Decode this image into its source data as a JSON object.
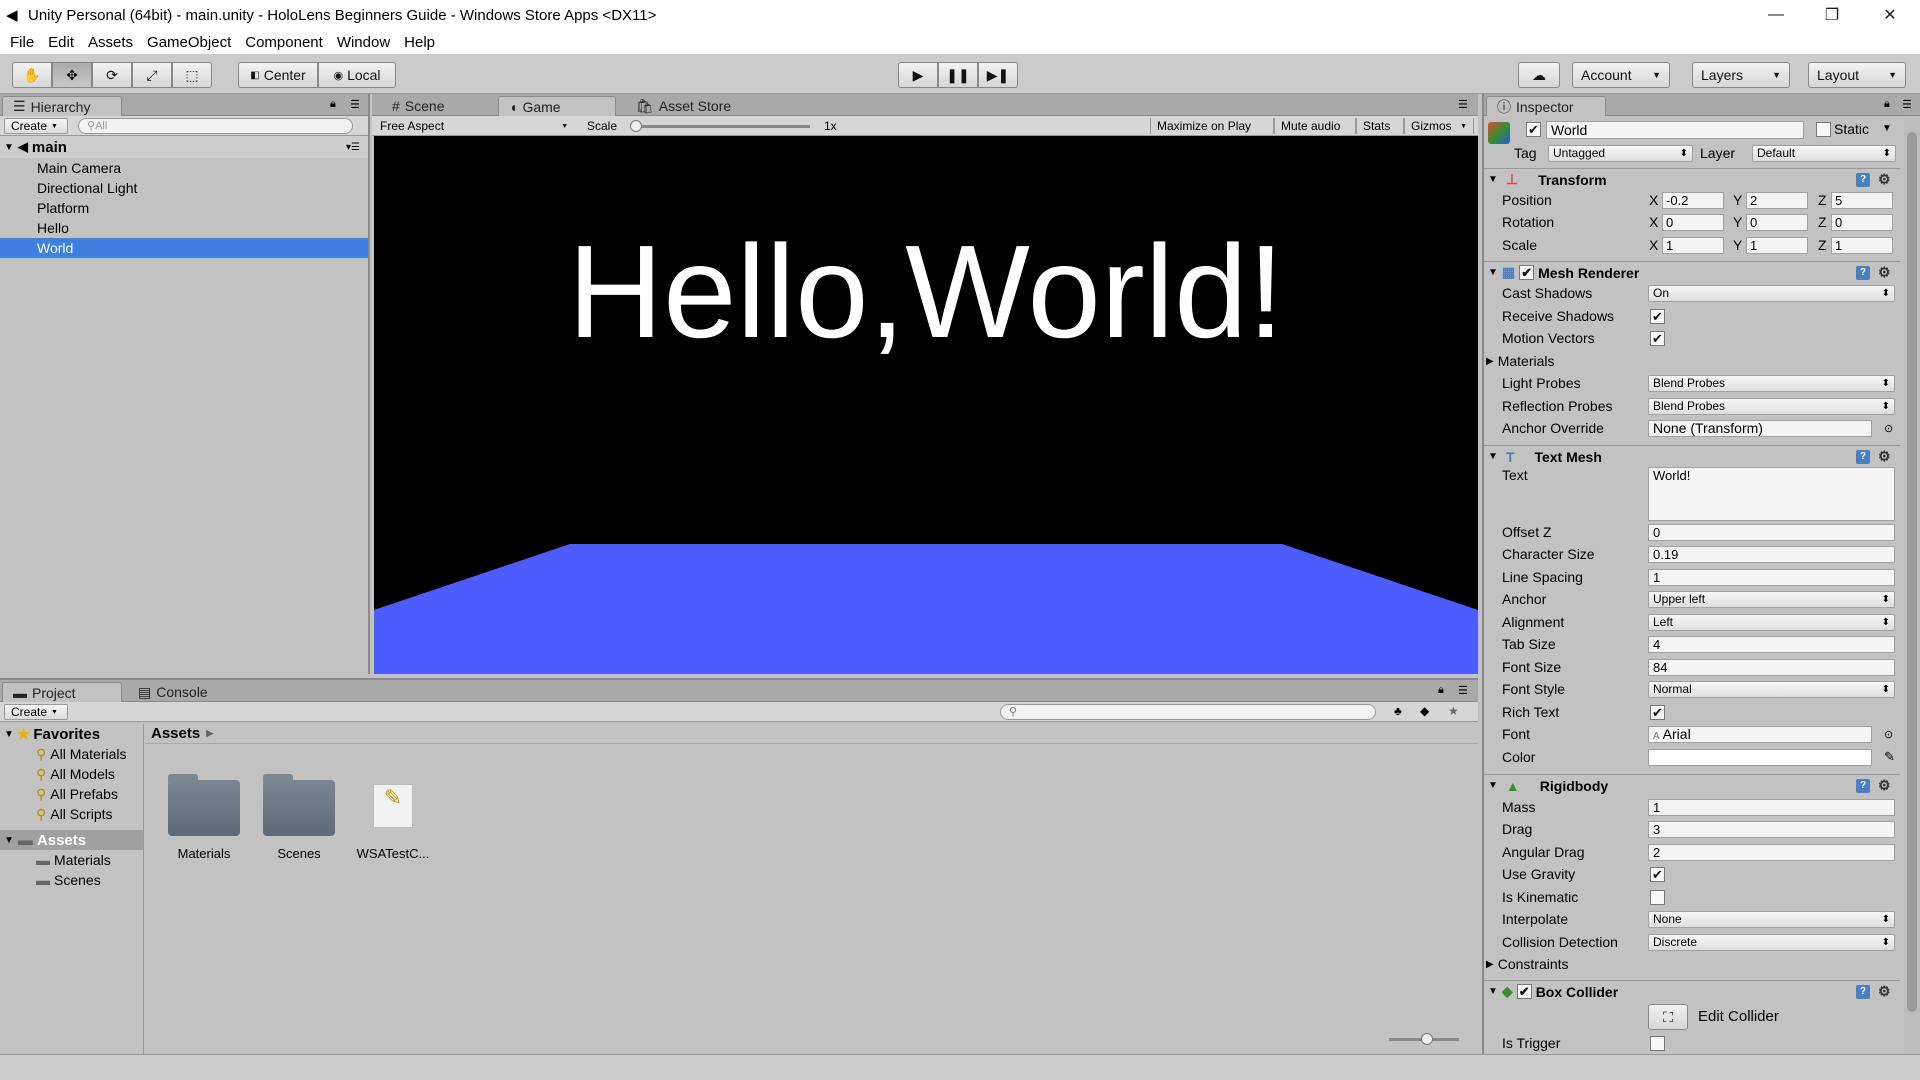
{
  "window": {
    "title": "Unity Personal (64bit) - main.unity - HoloLens Beginners Guide - Windows Store Apps <DX11>"
  },
  "menu": [
    "File",
    "Edit",
    "Assets",
    "GameObject",
    "Component",
    "Window",
    "Help"
  ],
  "toolbar": {
    "center": "Center",
    "local": "Local",
    "account": "Account",
    "layers": "Layers",
    "layout": "Layout"
  },
  "hierarchy": {
    "tab": "Hierarchy",
    "create": "Create",
    "search_placeholder": "All",
    "scene": "main",
    "items": [
      "Main Camera",
      "Directional Light",
      "Platform",
      "Hello",
      "World"
    ],
    "selected": "World"
  },
  "scene_tabs": {
    "scene": "Scene",
    "game": "Game",
    "asset_store": "Asset Store"
  },
  "game_bar": {
    "aspect": "Free Aspect",
    "scale_label": "Scale",
    "scale_value": "1x",
    "maximize": "Maximize on Play",
    "mute": "Mute audio",
    "stats": "Stats",
    "gizmos": "Gizmos"
  },
  "game_view": {
    "text": "Hello,World!",
    "colors": {
      "background": "#000000",
      "platform": "#4d5cff"
    }
  },
  "project": {
    "tab": "Project",
    "console": "Console",
    "create": "Create",
    "favorites_label": "Favorites",
    "favorites": [
      "All Materials",
      "All Models",
      "All Prefabs",
      "All Scripts"
    ],
    "assets_label": "Assets",
    "asset_folders": [
      "Materials",
      "Scenes"
    ],
    "breadcrumb": "Assets",
    "grid_items": [
      "Materials",
      "Scenes",
      "WSATestC..."
    ]
  },
  "inspector": {
    "tab": "Inspector",
    "name": "World",
    "static": "Static",
    "tag_label": "Tag",
    "tag": "Untagged",
    "layer_label": "Layer",
    "layer": "Default",
    "transform": {
      "title": "Transform",
      "position_label": "Position",
      "rotation_label": "Rotation",
      "scale_label": "Scale",
      "position": {
        "x": "-0.2",
        "y": "2",
        "z": "5"
      },
      "rotation": {
        "x": "0",
        "y": "0",
        "z": "0"
      },
      "scale": {
        "x": "1",
        "y": "1",
        "z": "1"
      }
    },
    "mesh_renderer": {
      "title": "Mesh Renderer",
      "cast_shadows_label": "Cast Shadows",
      "cast_shadows": "On",
      "receive_shadows_label": "Receive Shadows",
      "motion_vectors_label": "Motion Vectors",
      "materials_label": "Materials",
      "light_probes_label": "Light Probes",
      "light_probes": "Blend Probes",
      "reflection_probes_label": "Reflection Probes",
      "reflection_probes": "Blend Probes",
      "anchor_override_label": "Anchor Override",
      "anchor_override": "None (Transform)"
    },
    "text_mesh": {
      "title": "Text Mesh",
      "text_label": "Text",
      "text": "World!",
      "offset_z_label": "Offset Z",
      "offset_z": "0",
      "character_size_label": "Character Size",
      "character_size": "0.19",
      "line_spacing_label": "Line Spacing",
      "line_spacing": "1",
      "anchor_label": "Anchor",
      "anchor": "Upper left",
      "alignment_label": "Alignment",
      "alignment": "Left",
      "tab_size_label": "Tab Size",
      "tab_size": "4",
      "font_size_label": "Font Size",
      "font_size": "84",
      "font_style_label": "Font Style",
      "font_style": "Normal",
      "rich_text_label": "Rich Text",
      "font_label": "Font",
      "font": "Arial",
      "color_label": "Color"
    },
    "rigidbody": {
      "title": "Rigidbody",
      "mass_label": "Mass",
      "mass": "1",
      "drag_label": "Drag",
      "drag": "3",
      "angular_drag_label": "Angular Drag",
      "angular_drag": "2",
      "use_gravity_label": "Use Gravity",
      "is_kinematic_label": "Is Kinematic",
      "interpolate_label": "Interpolate",
      "interpolate": "None",
      "collision_label": "Collision Detection",
      "collision": "Discrete",
      "constraints_label": "Constraints"
    },
    "box_collider": {
      "title": "Box Collider",
      "edit_collider": "Edit Collider",
      "is_trigger_label": "Is Trigger"
    }
  }
}
